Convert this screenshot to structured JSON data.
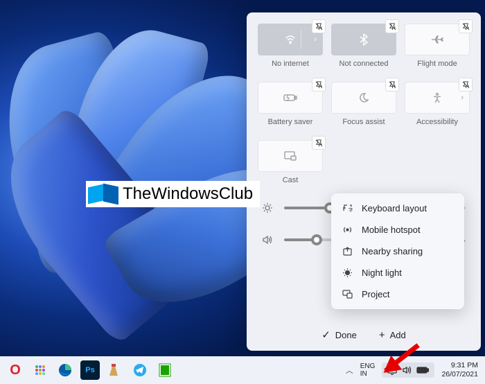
{
  "watermark": {
    "text": "TheWindowsClub"
  },
  "quickSettings": {
    "tiles": [
      {
        "label": "No internet",
        "icon": "wifi",
        "style": "dim",
        "hasChevron": true
      },
      {
        "label": "Not connected",
        "icon": "bluetooth",
        "style": "dim",
        "hasChevron": false
      },
      {
        "label": "Flight mode",
        "icon": "airplane",
        "style": "light",
        "hasChevron": false
      },
      {
        "label": "Battery saver",
        "icon": "battery",
        "style": "light",
        "hasChevron": false
      },
      {
        "label": "Focus assist",
        "icon": "moon",
        "style": "light",
        "hasChevron": false
      },
      {
        "label": "Accessibility",
        "icon": "accessibility",
        "style": "light",
        "hasChevron": true
      },
      {
        "label": "Cast",
        "icon": "cast",
        "style": "light",
        "hasChevron": false
      }
    ],
    "sliders": {
      "brightness": {
        "value": 25,
        "icon": "sun"
      },
      "volume": {
        "value": 20,
        "icon": "speaker",
        "hasChevron": true
      }
    },
    "footer": {
      "done": "Done",
      "add": "Add"
    }
  },
  "addMenu": {
    "items": [
      {
        "label": "Keyboard layout",
        "icon": "keyboard"
      },
      {
        "label": "Mobile hotspot",
        "icon": "hotspot"
      },
      {
        "label": "Nearby sharing",
        "icon": "share"
      },
      {
        "label": "Night light",
        "icon": "nightlight"
      },
      {
        "label": "Project",
        "icon": "project"
      }
    ]
  },
  "taskbar": {
    "lang": {
      "line1": "ENG",
      "line2": "IN"
    },
    "clock": {
      "time": "9:31 PM",
      "date": "26/07/2021"
    }
  }
}
